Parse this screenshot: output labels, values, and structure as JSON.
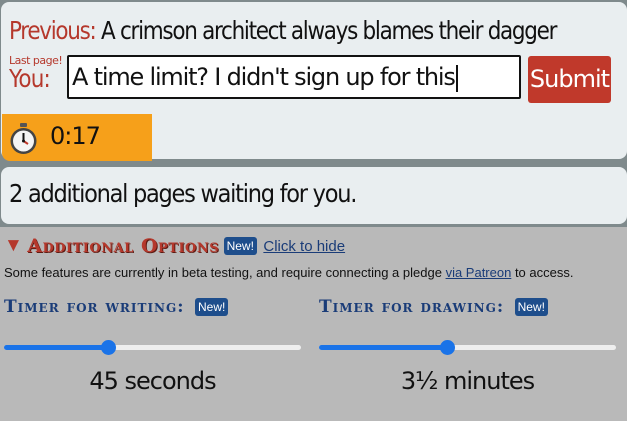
{
  "game": {
    "previous_label": "Previous:",
    "previous_text": "A crimson architect always blames their dagger",
    "last_page_label": "Last page!",
    "you_label": "You:",
    "input_value": "A time limit? I didn't sign up for this",
    "submit_label": "Submit",
    "timer_text": "0:17",
    "accent_color": "#c0392b",
    "timer_color": "#f6a01a"
  },
  "status": {
    "text": "2 additional pages waiting for you."
  },
  "options": {
    "arrow": "▼",
    "title": "Additional Options",
    "new_badge": "New!",
    "hide_link": "Click to hide",
    "beta_note_before": "Some features are currently in beta testing, and require connecting a pledge ",
    "beta_note_link": "via Patreon",
    "beta_note_after": " to access.",
    "writing_timer": {
      "label": "Timer for writing:",
      "badge": "New!",
      "value_text": "45 seconds",
      "level": 0.35
    },
    "drawing_timer": {
      "label": "Timer for drawing:",
      "badge": "New!",
      "value_text": "3½ minutes",
      "level": 0.43
    }
  }
}
